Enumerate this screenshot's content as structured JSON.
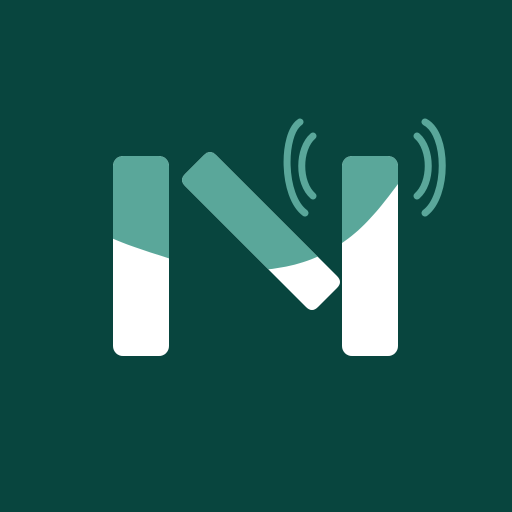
{
  "app_icon": {
    "letter": "N",
    "icon_name": "n-letter-broadcast-logo"
  },
  "colors": {
    "background": "#08453e",
    "accent": "#5aa79a",
    "letter_fill": "#ffffff"
  }
}
